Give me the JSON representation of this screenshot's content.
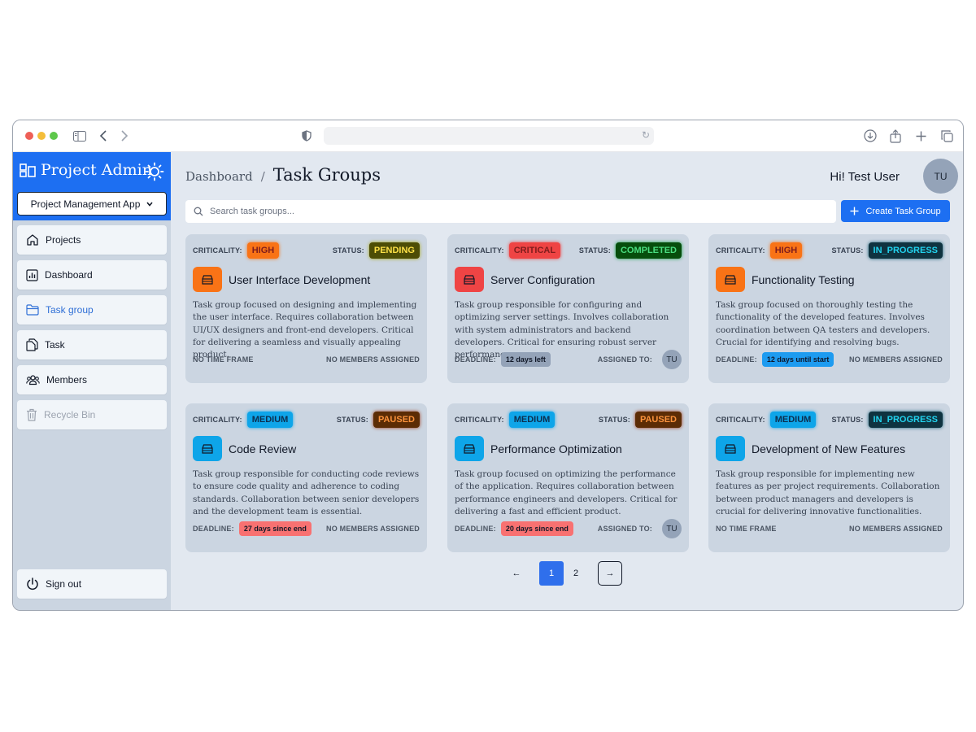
{
  "app": {
    "brand_title": "Project Admin",
    "project_selector": "Project Management App"
  },
  "sidebar": {
    "items": [
      {
        "label": "Projects",
        "icon": "home-icon"
      },
      {
        "label": "Dashboard",
        "icon": "chart-icon"
      },
      {
        "label": "Task group",
        "icon": "folder-icon",
        "active": true
      },
      {
        "label": "Task",
        "icon": "copy-icon"
      },
      {
        "label": "Members",
        "icon": "users-icon"
      },
      {
        "label": "Recycle Bin",
        "icon": "trash-icon",
        "disabled": true
      }
    ],
    "signout": "Sign out"
  },
  "header": {
    "breadcrumb_root": "Dashboard",
    "breadcrumb_sep": "/",
    "title": "Task Groups",
    "greeting": "Hi! Test User",
    "avatar_initials": "TU"
  },
  "search": {
    "placeholder": "Search task groups...",
    "value": ""
  },
  "create_button": "Create Task Group",
  "labels": {
    "criticality": "CRITICALITY:",
    "status": "STATUS:",
    "deadline": "DEADLINE:",
    "assigned_to": "ASSIGNED TO:"
  },
  "cards": [
    {
      "criticality": "HIGH",
      "status": "PENDING",
      "title": "User Interface Development",
      "description": "Task group focused on designing and implementing the user interface. Requires collaboration between UI/UX designers and front-end developers. Critical for delivering a seamless and visually appealing product.",
      "footer_left": "NO TIME FRAME",
      "footer_right": "NO MEMBERS ASSIGNED",
      "icon_color": "#f97316"
    },
    {
      "criticality": "CRITICAL",
      "status": "COMPLETED",
      "title": "Server Configuration",
      "description": "Task group responsible for configuring and optimizing server settings. Involves collaboration with system administrators and backend developers. Critical for ensuring robust server performance.",
      "deadline_badge": "12 days left",
      "assigned_initials": "TU",
      "icon_color": "#ef4444"
    },
    {
      "criticality": "HIGH",
      "status": "IN_PROGRESS",
      "title": "Functionality Testing",
      "description": "Task group focused on thoroughly testing the functionality of the developed features. Involves coordination between QA testers and developers. Crucial for identifying and resolving bugs.",
      "deadline_badge": "12 days until start",
      "footer_right": "NO MEMBERS ASSIGNED",
      "icon_color": "#f97316"
    },
    {
      "criticality": "MEDIUM",
      "status": "PAUSED",
      "title": "Code Review",
      "description": "Task group responsible for conducting code reviews to ensure code quality and adherence to coding standards. Collaboration between senior developers and the development team is essential.",
      "deadline_badge": "27 days since end",
      "footer_right": "NO MEMBERS ASSIGNED",
      "icon_color": "#0ea5e9"
    },
    {
      "criticality": "MEDIUM",
      "status": "PAUSED",
      "title": "Performance Optimization",
      "description": "Task group focused on optimizing the performance of the application. Requires collaboration between performance engineers and developers. Critical for delivering a fast and efficient product.",
      "deadline_badge": "20 days since end",
      "assigned_initials": "TU",
      "icon_color": "#0ea5e9"
    },
    {
      "criticality": "MEDIUM",
      "status": "IN_PROGRESS",
      "title": "Development of New Features",
      "description": "Task group responsible for implementing new features as per project requirements. Collaboration between product managers and developers is crucial for delivering innovative functionalities.",
      "footer_left": "NO TIME FRAME",
      "footer_right": "NO MEMBERS ASSIGNED",
      "icon_color": "#0ea5e9"
    }
  ],
  "pagination": {
    "prev": "←",
    "pages": [
      "1",
      "2"
    ],
    "current": "1",
    "next": "→"
  },
  "colors": {
    "brand": "#1d6ff2",
    "sidebar_bg": "#cbd5e1",
    "main_bg": "#e2e8f0",
    "card_bg": "#cbd5e1"
  }
}
